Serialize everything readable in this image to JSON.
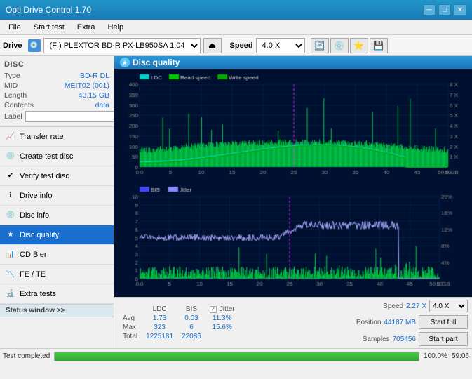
{
  "window": {
    "title": "Opti Drive Control 1.70"
  },
  "title_controls": {
    "minimize": "─",
    "maximize": "□",
    "close": "✕"
  },
  "menu": {
    "items": [
      "File",
      "Start test",
      "Extra",
      "Help"
    ]
  },
  "drive_toolbar": {
    "drive_label": "Drive",
    "drive_value": "(F:)  PLEXTOR BD-R  PX-LB950SA 1.04",
    "speed_label": "Speed",
    "speed_value": "4.0 X"
  },
  "disc": {
    "section_title": "Disc",
    "fields": [
      {
        "label": "Type",
        "value": "BD-R DL"
      },
      {
        "label": "MID",
        "value": "MEIT02 (001)"
      },
      {
        "label": "Length",
        "value": "43.15 GB"
      },
      {
        "label": "Contents",
        "value": "data"
      },
      {
        "label": "Label",
        "value": ""
      }
    ]
  },
  "sidebar": {
    "items": [
      {
        "id": "transfer-rate",
        "label": "Transfer rate",
        "icon": "📈"
      },
      {
        "id": "create-test-disc",
        "label": "Create test disc",
        "icon": "💿"
      },
      {
        "id": "verify-test-disc",
        "label": "Verify test disc",
        "icon": "✔"
      },
      {
        "id": "drive-info",
        "label": "Drive info",
        "icon": "ℹ"
      },
      {
        "id": "disc-info",
        "label": "Disc info",
        "icon": "💿"
      },
      {
        "id": "disc-quality",
        "label": "Disc quality",
        "icon": "★",
        "active": true
      },
      {
        "id": "cd-bler",
        "label": "CD Bler",
        "icon": "📊"
      },
      {
        "id": "fe-te",
        "label": "FE / TE",
        "icon": "📉"
      },
      {
        "id": "extra-tests",
        "label": "Extra tests",
        "icon": "🔬"
      }
    ],
    "status_window": "Status window >>",
    "status_window_section": "Status window >>"
  },
  "disc_quality": {
    "title": "Disc quality",
    "legend": {
      "ldc": "LDC",
      "read_speed": "Read speed",
      "write_speed": "Write speed",
      "bis": "BIS",
      "jitter": "Jitter"
    }
  },
  "stats": {
    "columns": [
      "LDC",
      "BIS",
      "Jitter"
    ],
    "rows": [
      {
        "label": "Avg",
        "ldc": "1.73",
        "bis": "0.03",
        "jitter": "11.3%"
      },
      {
        "label": "Max",
        "ldc": "323",
        "bis": "6",
        "jitter": "15.6%"
      },
      {
        "label": "Total",
        "ldc": "1225181",
        "bis": "22086",
        "jitter": ""
      }
    ],
    "jitter_checked": true,
    "speed_label": "Speed",
    "speed_value": "2.27 X",
    "speed_select": "4.0 X",
    "position_label": "Position",
    "position_value": "44187 MB",
    "samples_label": "Samples",
    "samples_value": "705456",
    "start_full": "Start full",
    "start_part": "Start part"
  },
  "status": {
    "completed": "Test completed",
    "progress": "100.0%",
    "time": "59:06",
    "progress_value": 100
  },
  "colors": {
    "ldc": "#00ffff",
    "read_speed": "#00c800",
    "write_speed": "#008800",
    "bis": "#0000ff",
    "jitter": "#8888ff",
    "bg": "#001030",
    "grid": "#003060"
  }
}
